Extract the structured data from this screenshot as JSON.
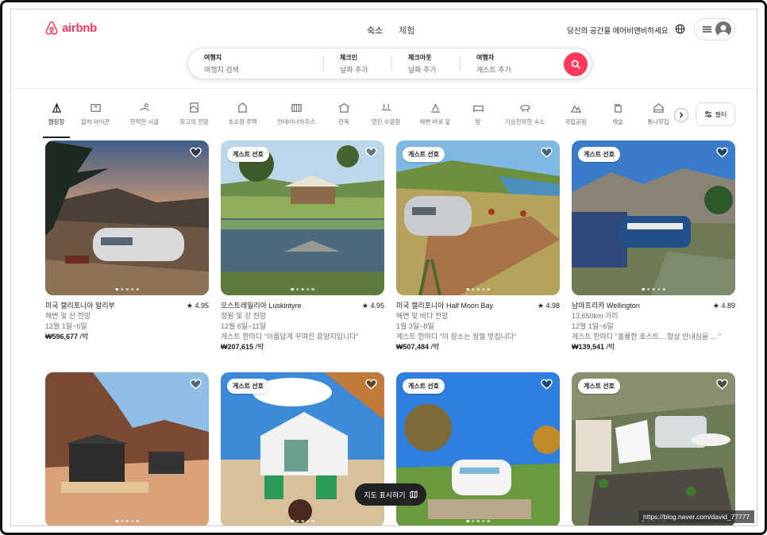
{
  "brand": {
    "name": "airbnb",
    "color": "#ff385c"
  },
  "topnav": {
    "stays": "숙소",
    "experiences": "체험"
  },
  "host_link": "당신의 공간을 에어비앤비하세요",
  "icons": {
    "globe": "globe-icon",
    "menu": "hamburger-icon",
    "avatar": "user-avatar-icon",
    "search": "search-icon",
    "heart": "heart-icon",
    "map": "map-icon",
    "filter": "sliders-icon",
    "next": "chevron-right-icon"
  },
  "search": {
    "where_label": "여행지",
    "where_placeholder": "여행지 검색",
    "checkin_label": "체크인",
    "checkin_placeholder": "날짜 추가",
    "checkout_label": "체크아웃",
    "checkout_placeholder": "날짜 추가",
    "guests_label": "여행자",
    "guests_placeholder": "게스트 추가"
  },
  "categories": [
    "캠핑장",
    "컬처 아이콘",
    "한적한 시골",
    "최고의 전망",
    "초소형 주택",
    "컨테이너하우스",
    "한옥",
    "멋진 수영장",
    "해변 바로 앞",
    "방",
    "기상천외한 숙소",
    "국립공원",
    "캐슬",
    "통나무집"
  ],
  "filter_label": "필터",
  "listings": [
    {
      "badge": "",
      "location": "미국 캘리포니아 말리부",
      "rating": "★ 4.95",
      "line2": "해변 및 산 전망",
      "line3": "12월 1일~6일",
      "line4": "",
      "price": "₩596,677",
      "per": " /박"
    },
    {
      "badge": "게스트 선호",
      "location": "오스트레일리아 Luskintyre",
      "rating": "★ 4.95",
      "line2": "정원 및 강 전망",
      "line3": "12월 6일~11일",
      "line4": "게스트 한마디 \"아름답게 꾸며진 휴양지입니다\"",
      "price": "₩207,615",
      "per": " /박"
    },
    {
      "badge": "게스트 선호",
      "location": "미국 캘리포니아 Half Moon Bay",
      "rating": "★ 4.98",
      "line2": "해변 및 바다 전망",
      "line3": "1월 3일~8일",
      "line4": "게스트 한마디 \"이 장소는 정말 멋집니다\"",
      "price": "₩507,484",
      "per": " /박"
    },
    {
      "badge": "게스트 선호",
      "location": "남아프리카 Wellington",
      "rating": "★ 4.89",
      "line2": "13,650km 거리",
      "line3": "12월 1일~6일",
      "line4": "게스트 한마디 \"훌륭한 호스트... 항상 안내심을 ... \"",
      "price": "₩139,541",
      "per": " /박"
    },
    {
      "badge": ""
    },
    {
      "badge": "게스트 선호"
    },
    {
      "badge": "게스트 선호"
    },
    {
      "badge": "게스트 선호"
    }
  ],
  "map_button": "지도 표시하기",
  "watermark": "https://blog.naver.com/david_77777"
}
